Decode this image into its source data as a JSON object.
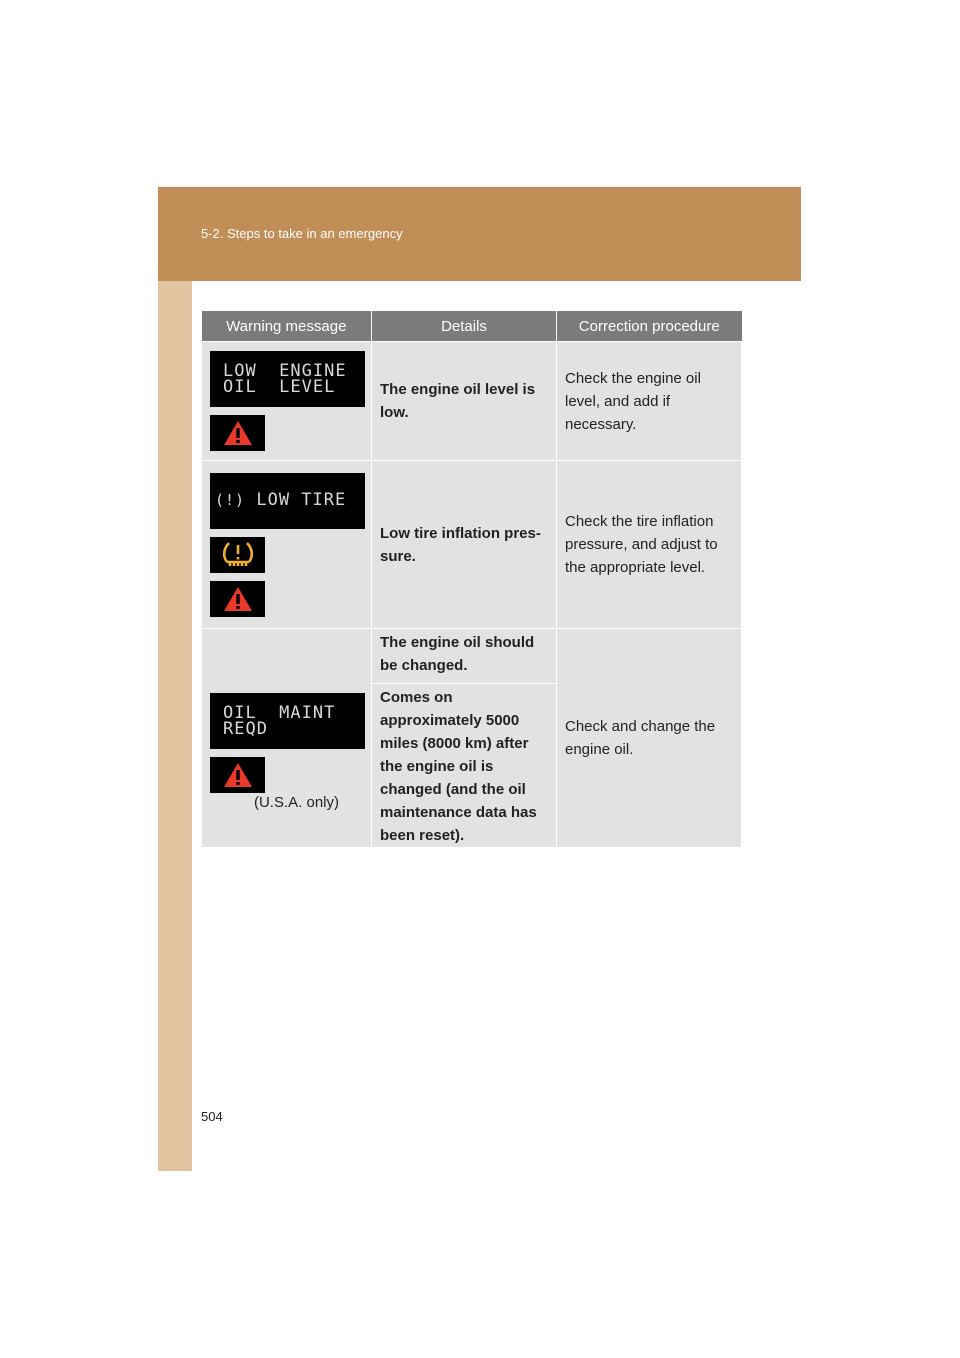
{
  "header": {
    "section_title": "5-2. Steps to take in an emergency"
  },
  "colors": {
    "header_band": "#c18e57",
    "side_strip": "#e2c4a0",
    "table_header": "#7b7b7b",
    "table_cell": "#e2e2e2",
    "warning_red": "#e8392b",
    "tire_amber": "#f0b030"
  },
  "table": {
    "headers": [
      "Warning message",
      "Details",
      "Correction procedure"
    ],
    "rows": [
      {
        "display_text": "LOW  ENGINE\nOIL  LEVEL",
        "indicators": [
          "master-warning-icon"
        ],
        "details": "The engine oil level is low.",
        "correction": "Check the engine oil level, and add if necessary."
      },
      {
        "display_text": "LOW TIRE",
        "display_icon": "tire-pressure-icon",
        "indicators": [
          "tire-pressure-warning-icon",
          "master-warning-icon"
        ],
        "details": "Low tire inflation pres- sure.",
        "correction": "Check the tire inflation pressure, and adjust to the appropriate level."
      },
      {
        "display_text": "OIL  MAINT\nREQD",
        "indicators": [
          "master-warning-icon"
        ],
        "note": "(U.S.A. only)",
        "details": [
          "The engine oil should be changed.",
          "Comes on approximately 5000 miles (8000 km) after the engine oil is changed (and the oil maintenance data has been reset)."
        ],
        "correction": "Check and change the engine oil."
      }
    ]
  },
  "footer": {
    "page_number": "504"
  }
}
